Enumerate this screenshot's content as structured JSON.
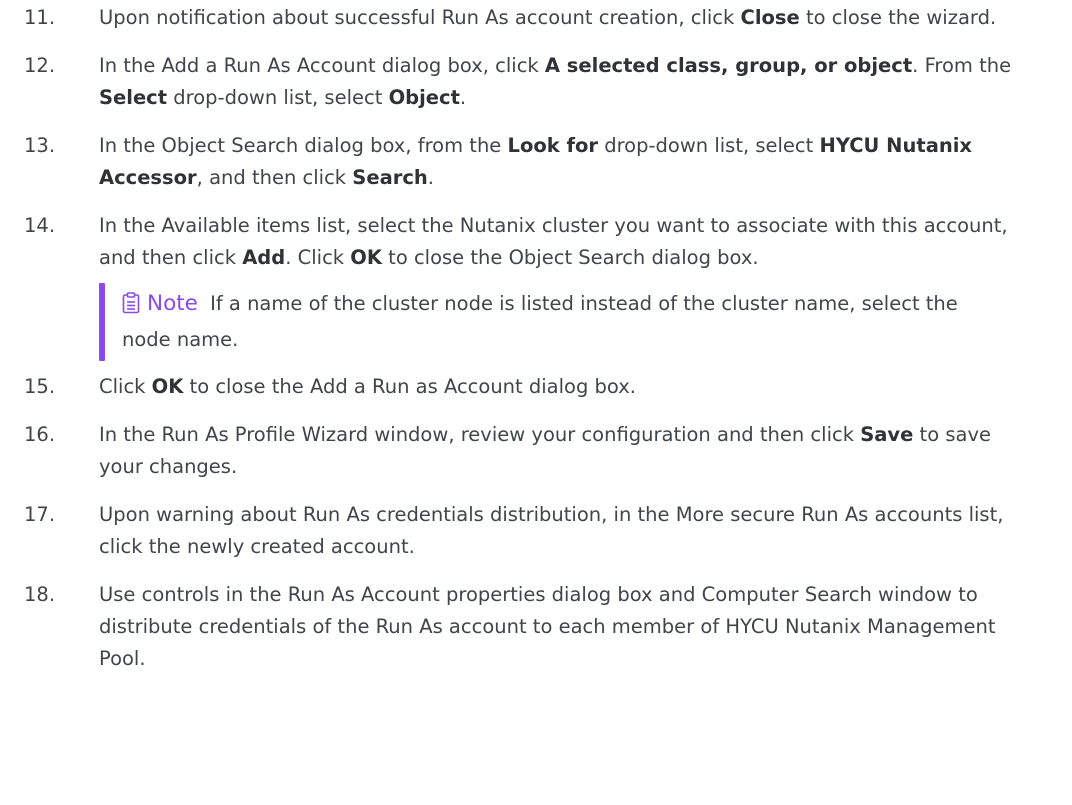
{
  "steps": [
    {
      "num": "11.",
      "parts": [
        {
          "t": "Upon notification about successful Run As account creation, click "
        },
        {
          "t": "Close",
          "b": true
        },
        {
          "t": " to close the wizard."
        }
      ]
    },
    {
      "num": "12.",
      "parts": [
        {
          "t": "In the Add a Run As Account dialog box, click "
        },
        {
          "t": "A selected class, group, or object",
          "b": true
        },
        {
          "t": ". From the "
        },
        {
          "t": "Select",
          "b": true
        },
        {
          "t": " drop-down list, select "
        },
        {
          "t": "Object",
          "b": true
        },
        {
          "t": "."
        }
      ]
    },
    {
      "num": "13.",
      "parts": [
        {
          "t": "In the Object Search dialog box, from the "
        },
        {
          "t": "Look for",
          "b": true
        },
        {
          "t": " drop-down list, select "
        },
        {
          "t": "HYCU Nutanix Accessor",
          "b": true
        },
        {
          "t": ", and then click "
        },
        {
          "t": "Search",
          "b": true
        },
        {
          "t": "."
        }
      ]
    },
    {
      "num": "14.",
      "parts": [
        {
          "t": "In the Available items list, select the Nutanix cluster you want to associate with this account, and then click "
        },
        {
          "t": "Add",
          "b": true
        },
        {
          "t": ". Click "
        },
        {
          "t": "OK",
          "b": true
        },
        {
          "t": " to close the Object Search dialog box."
        }
      ],
      "note": {
        "label": "Note",
        "text": "If a name of the cluster node is listed instead of the cluster name, select the node name."
      }
    },
    {
      "num": "15.",
      "parts": [
        {
          "t": "Click "
        },
        {
          "t": "OK",
          "b": true
        },
        {
          "t": " to close the Add a Run as Account dialog box."
        }
      ]
    },
    {
      "num": "16.",
      "parts": [
        {
          "t": "In the Run As Profile Wizard window, review your configuration and then click "
        },
        {
          "t": "Save",
          "b": true
        },
        {
          "t": " to save your changes."
        }
      ]
    },
    {
      "num": "17.",
      "parts": [
        {
          "t": "Upon warning about Run As credentials distribution, in the More secure Run As accounts list, click the newly created account."
        }
      ]
    },
    {
      "num": "18.",
      "parts": [
        {
          "t": "Use controls in the Run As Account properties dialog box and Computer Search window to distribute credentials of the Run As account to each member of HYCU Nutanix Management Pool."
        }
      ]
    }
  ],
  "colors": {
    "text": "#3f4549",
    "accent": "#8a4bea"
  },
  "icons": {
    "note": "note-icon"
  }
}
